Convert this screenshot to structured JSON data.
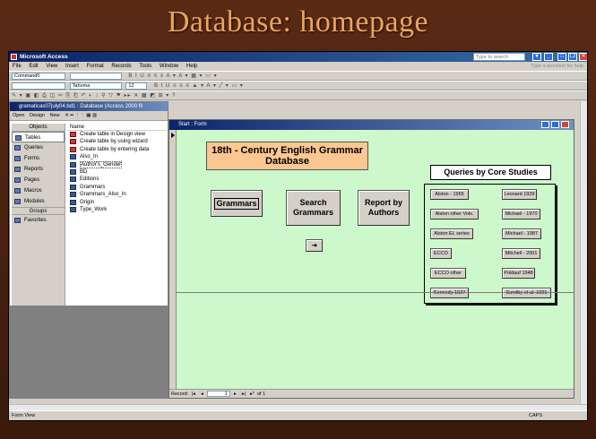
{
  "slide": {
    "title": "Database: homepage"
  },
  "app": {
    "title": "Microsoft Access",
    "type_to_search": "Type to search",
    "help_hint": "Type a question for help"
  },
  "menu": [
    "File",
    "Edit",
    "View",
    "Insert",
    "Format",
    "Records",
    "Tools",
    "Window",
    "Help"
  ],
  "toolbar": {
    "object_combo": "Command0",
    "font_combo": "Tahoma",
    "size_combo": "12"
  },
  "db_window": {
    "title": "gramaticas07july04.bd1 : Database (Access 2000 fil",
    "toolbar": [
      "Open",
      "Design",
      "New"
    ],
    "objects_header": "Objects",
    "objects": [
      "Tables",
      "Queries",
      "Forms",
      "Reports",
      "Pages",
      "Macros",
      "Modules"
    ],
    "groups_header": "Groups",
    "groups": [
      "Favorites"
    ],
    "list_header": "Name",
    "items": [
      "Create table in Design view",
      "Create table by using wizard",
      "Create table by entering data",
      "Also_In",
      "Author's_Gender",
      "BD",
      "Editions",
      "Grammars",
      "Grammars_Also_In",
      "Origin",
      "Type_Work"
    ]
  },
  "form": {
    "window_title": "Start : Form",
    "header": "18th - Century English Grammar Database",
    "grammars_button": "Grammars",
    "search_button": "Search Grammars",
    "report_button": "Report by Authors",
    "exit_glyph": "⇥",
    "queries_title": "Queries by Core Studies",
    "query_left": [
      "Alston - 1965",
      "Alston other Vols.",
      "Alston EL series",
      "ECCO",
      "ECCO other",
      "Kennedy 1927"
    ],
    "query_right": [
      "Leonard 1929",
      "Michael - 1970",
      "Michael - 1987",
      "Mitchell - 2001",
      "Poldauf 1948",
      "Sundby et al. 1991"
    ],
    "record_label": "Record:",
    "record_value": "1",
    "record_of": "of 1"
  },
  "status": {
    "left": "Form View",
    "caps": "CAPS"
  }
}
